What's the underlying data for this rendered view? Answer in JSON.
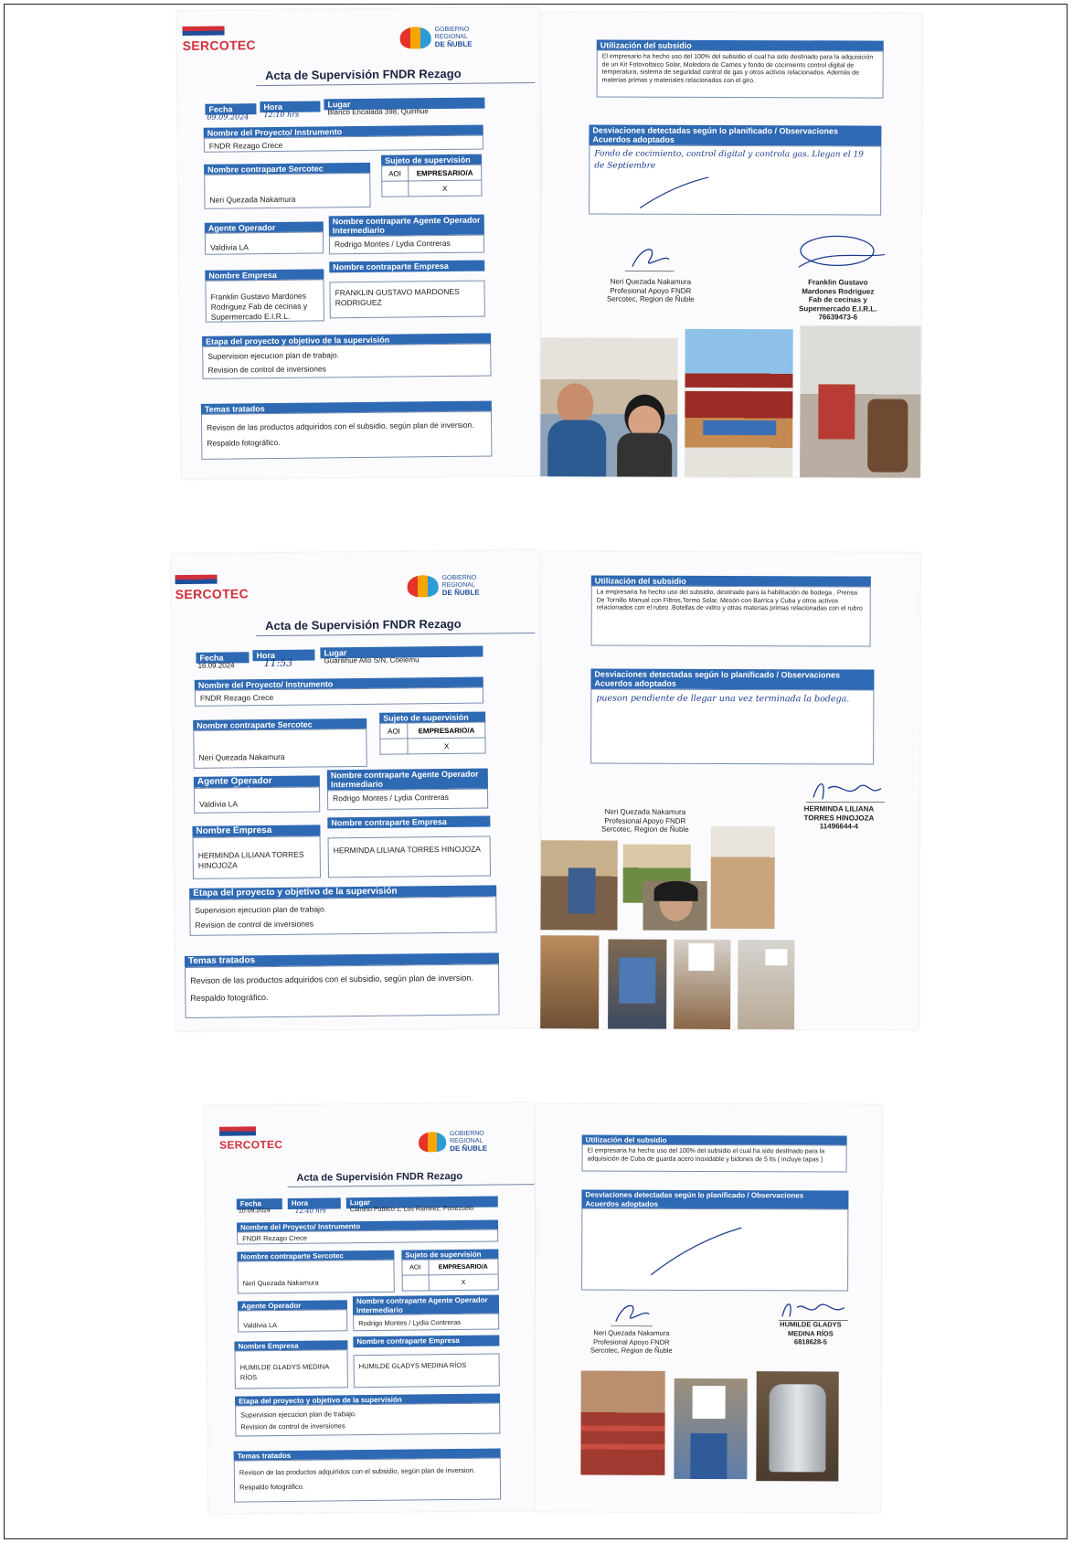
{
  "common": {
    "sercotec": "SERCOTEC",
    "gob_line1": "GOBIERNO",
    "gob_line2": "REGIONAL",
    "gob_line3": "DE ÑUBLE",
    "title": "Acta de Supervisión FNDR Rezago",
    "lbl_fecha": "Fecha",
    "lbl_hora": "Hora",
    "lbl_lugar": "Lugar",
    "lbl_proyecto": "Nombre del Proyecto/ Instrumento",
    "proyecto": "FNDR Rezago Crece",
    "lbl_contraparte_sercotec": "Nombre contraparte Sercotec",
    "contraparte_sercotec": "Neri Quezada Nakamura",
    "lbl_sujeto": "Sujeto de supervisión",
    "col_aoi": "AOI",
    "col_empresario": "EMPRESARIO/A",
    "mark": "X",
    "lbl_agente": "Agente Operador Intermediario",
    "agente": "Valdivia LA",
    "lbl_contraparte_agente": "Nombre contraparte Agente Operador Intermediario",
    "contraparte_agente": "Rodrigo Montes / Lydia Contreras",
    "lbl_empresa": "Nombre Empresa",
    "lbl_contraparte_empresa": "Nombre contraparte Empresa",
    "lbl_etapa": "Etapa del proyecto y objetivo de la supervisión",
    "etapa_1": "Supervision ejecucion plan de trabajo.",
    "etapa_2": "Revision de control de inversiones",
    "lbl_temas": "Temas tratados",
    "temas_1": "Revison de las productos adquiridos con el subsidio, según plan de inversion.",
    "temas_2": "Respaldo fotográfico.",
    "lbl_utilizacion": "Utilización del subsidio",
    "lbl_desviaciones": "Desviaciones detectadas según lo planificado / Observaciones",
    "lbl_acuerdos": "Acuerdos adoptados",
    "firma_sercotec_1": "Neri Quezada Nakamura",
    "firma_sercotec_2": "Profesional Apoyo FNDR",
    "firma_sercotec_3": "Sercotec, Region de Ñuble"
  },
  "actas": [
    {
      "fecha": "09.09.2024",
      "hora": "12:10 hrs",
      "lugar": "Blanco Encalada 398, Quirihue",
      "empresa": "Franklin Gustavo Mardones Rodriguez Fab de cecinas y Supermercado E.I.R.L.",
      "contraparte_empresa": "FRANKLIN GUSTAVO MARDONES RODRIGUEZ",
      "utilizacion": "El empresario ha hecho uso del 100% del subsidio el cual ha sido destinado para la adquisición de un Kit Fotovoltaico Solar, Moledora de Carnes y fondo de cocimiento control digital de temperatura, sistema de seguridad control de gas y otros activos relacionados. Además de materias primas y materiales relacionados con el giro.",
      "observacion": "Fondo de cocimiento, control digital y controla gas. Llegan el 19 de Septiembre",
      "firma_1": "Franklin Gustavo",
      "firma_2": "Mardones Rodriguez",
      "firma_3": "Fab de cecinas y",
      "firma_4": "Supermercado E.I.R.L.",
      "firma_5": "76639473-6"
    },
    {
      "fecha": "16.09.2024",
      "hora": "11:53",
      "lugar": "Guarilihue Alto S/N, Coelemu",
      "empresa": "HERMINDA LILIANA TORRES HINOJOZA",
      "contraparte_empresa": "HERMINDA LILIANA TORRES HINOJOZA",
      "utilizacion": "La empresaria ha hecho uso del subsidio, destinado para la habilitación de bodega , Prensa De Tornillo Manual con Filtros,Termo Solar, Mesón con Barrica y Cuba y otros activos relacionados con el rubro .Botellas de vidrio y otras materias primas relacionadas con el rubro",
      "observacion": "pueson pendiente de llegar una vez terminada la bodega.",
      "firma_1": "HERMINDA LILIANA",
      "firma_2": "TORRES HINOJOZA",
      "firma_3": "11496644-4"
    },
    {
      "fecha": "10.09.2024",
      "hora": "12:40 hrs",
      "lugar": "Camino Publico 1, Los Ramirez, Portezuelo",
      "empresa": "HUMILDE GLADYS MEDINA RÍOS",
      "contraparte_empresa": "HUMILDE GLADYS MEDINA RÍOS",
      "utilizacion": "El empresaria ha hecho uso del 100% del subsidio el cual ha sido destinado para la adquisición de Cuba de guarda acero inoxidable y bidones de 5 lts ( incluye tapas )",
      "firma_1": "HUMILDE GLADYS",
      "firma_2": "MEDINA RÍOS",
      "firma_3": "6818628-5"
    }
  ]
}
